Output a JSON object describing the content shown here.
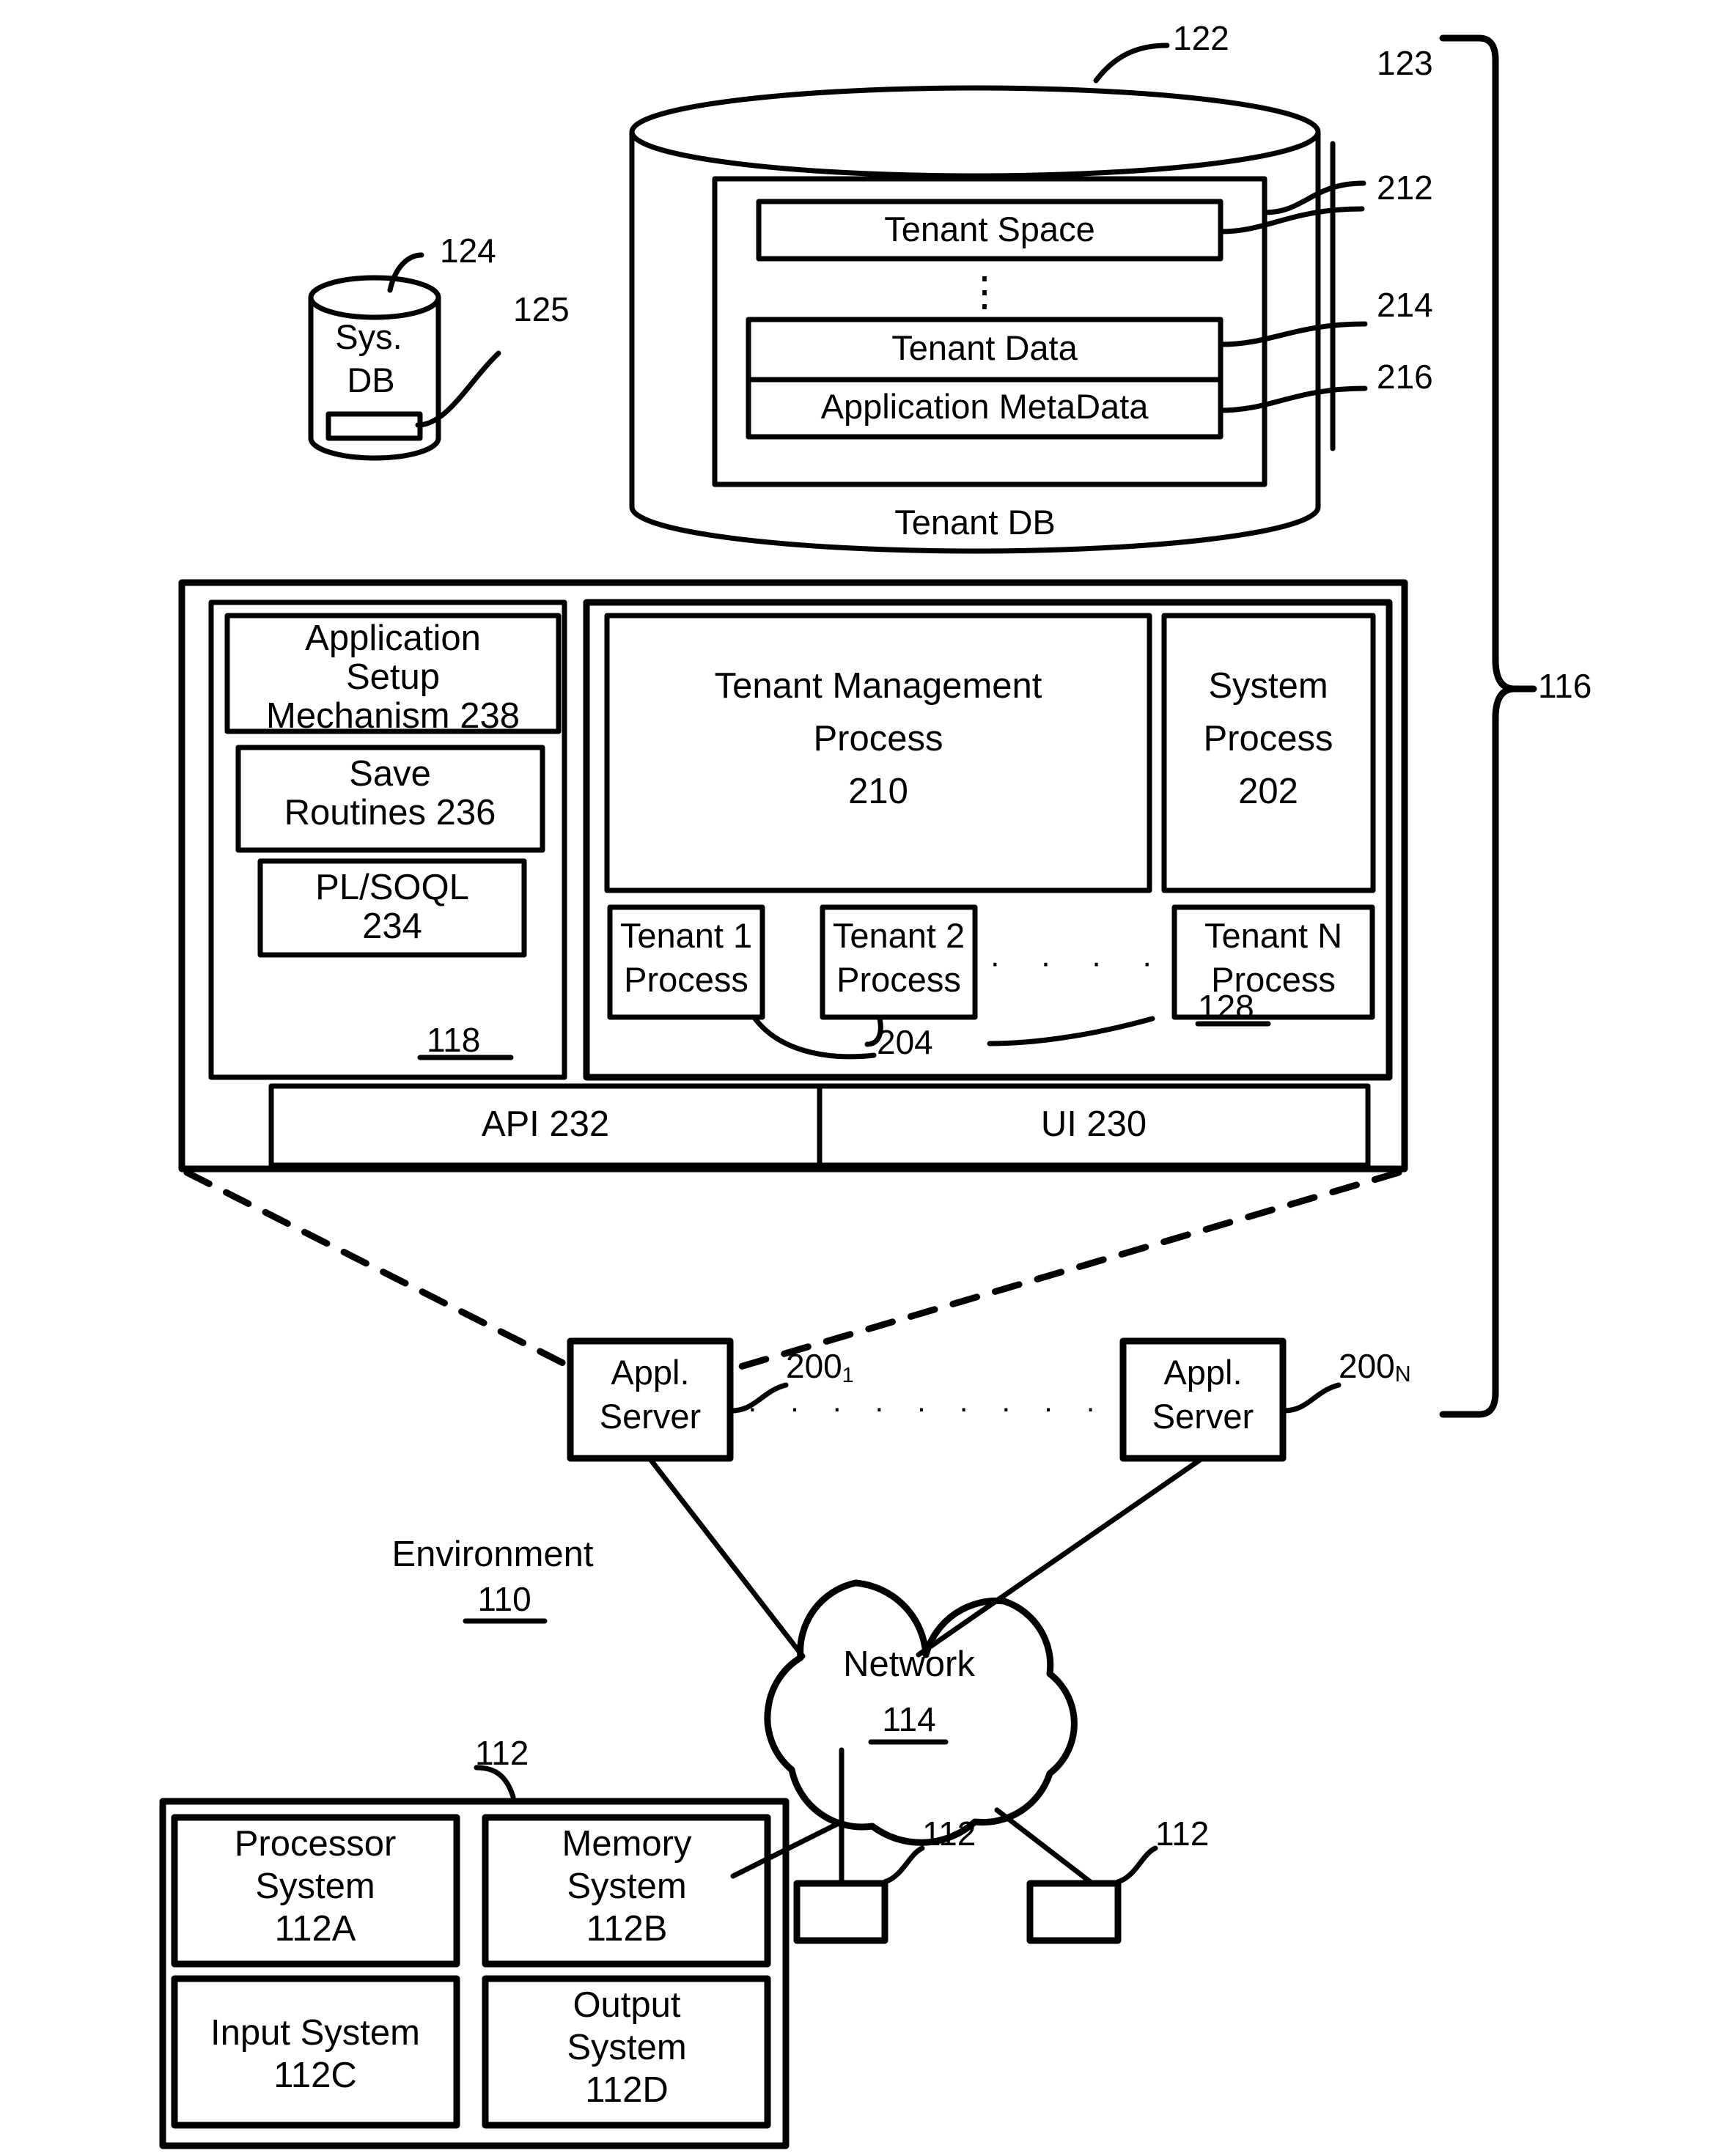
{
  "figure": {
    "title": "Multi-tenant on-demand database system architecture",
    "line_color": "#000000",
    "background": "#ffffff"
  },
  "tenant_db": {
    "cylinder_label": "Tenant DB",
    "ref_cylinder": "122",
    "ref_tenant_storage_area": "123",
    "inner_boxes": [
      {
        "label": "Tenant Space",
        "ref": "212"
      },
      {
        "label": "Tenant Data",
        "ref": "214"
      },
      {
        "label": "Application MetaData",
        "ref": "216"
      }
    ],
    "vertical_ellipsis": "⋮"
  },
  "sys_db": {
    "line1": "Sys.",
    "line2": "DB",
    "ref_cylinder": "124",
    "ref_inner": "125"
  },
  "app_server_detail": {
    "ref_process_space": "118",
    "ref_tenant_process_space": "128",
    "left_stack": [
      {
        "lines": [
          "Application",
          "Setup",
          "Mechanism 238"
        ],
        "name": "application-setup-mechanism"
      },
      {
        "lines": [
          "Save",
          "Routines 236"
        ],
        "name": "save-routines"
      },
      {
        "lines": [
          "PL/SOQL",
          "234"
        ],
        "name": "pl-soql"
      }
    ],
    "tenant_management_process": {
      "lines": [
        "Tenant Management",
        "Process",
        "210"
      ]
    },
    "system_process": {
      "lines": [
        "System",
        "Process",
        "202"
      ]
    },
    "tenant_processes": [
      {
        "lines": [
          "Tenant 1",
          "Process"
        ]
      },
      {
        "lines": [
          "Tenant 2",
          "Process"
        ]
      },
      {
        "lines": [
          "Tenant N",
          "Process"
        ]
      }
    ],
    "tenant_process_ellipsis": "·  ·  ·  ·",
    "ref_tenant_process": "204",
    "bottom_bar": [
      {
        "label": "API 232"
      },
      {
        "label": "UI 230"
      }
    ]
  },
  "system_bracket": {
    "ref": "116"
  },
  "app_servers": [
    {
      "line1": "Appl.",
      "line2": "Server",
      "ref_base": "200",
      "ref_sub": "1"
    },
    {
      "line1": "Appl.",
      "line2": "Server",
      "ref_base": "200",
      "ref_sub": "N"
    }
  ],
  "app_server_ellipsis": "· · · · · · · · ·",
  "environment": {
    "label": "Environment",
    "ref": "110"
  },
  "network": {
    "label": "Network",
    "ref": "114"
  },
  "user_system": {
    "ref": "112",
    "quadrants": [
      {
        "lines": [
          "Processor",
          "System",
          "112A"
        ]
      },
      {
        "lines": [
          "Memory",
          "System",
          "112B"
        ]
      },
      {
        "lines": [
          "Input System",
          "112C"
        ]
      },
      {
        "lines": [
          "Output",
          "System",
          "112D"
        ]
      }
    ]
  },
  "user_terminals": [
    {
      "ref": "112"
    },
    {
      "ref": "112"
    }
  ]
}
